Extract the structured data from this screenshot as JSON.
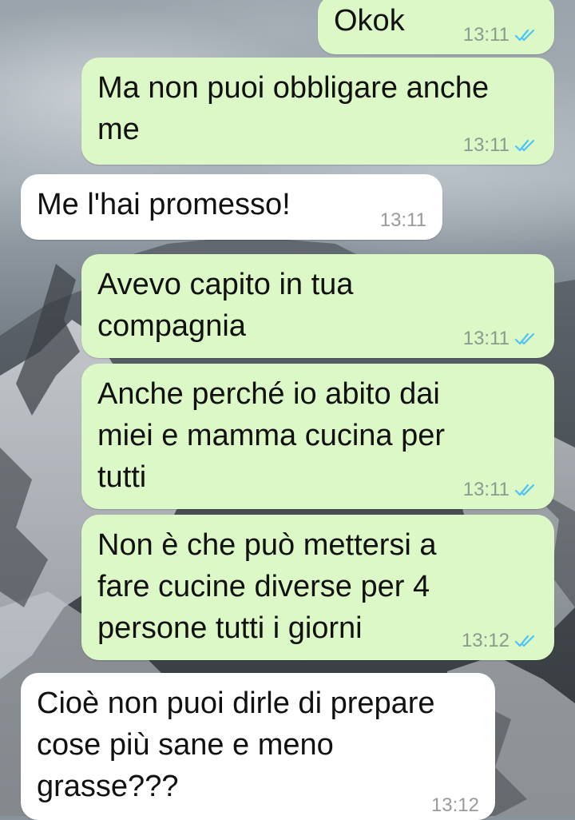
{
  "conversation": {
    "messages": [
      {
        "direction": "out",
        "text": "Okok",
        "time": "13:11",
        "read": true
      },
      {
        "direction": "out",
        "text": "Ma non puoi obbligare anche\nme",
        "time": "13:11",
        "read": true
      },
      {
        "direction": "in",
        "text": "Me l'hai promesso!",
        "time": "13:11"
      },
      {
        "direction": "out",
        "text": "Avevo capito in tua\ncompagnia",
        "time": "13:11",
        "read": true
      },
      {
        "direction": "out",
        "text": "Anche perché io abito dai\nmiei e mamma cucina per\ntutti",
        "time": "13:11",
        "read": true
      },
      {
        "direction": "out",
        "text": "Non è che può mettersi a\nfare cucine diverse per 4\npersone tutti i giorni",
        "time": "13:12",
        "read": true
      },
      {
        "direction": "in",
        "text": "Cioè non puoi dirle di prepare\ncose più sane e meno\ngrasse???",
        "time": "13:12"
      }
    ]
  },
  "colors": {
    "outgoing_bubble": "#dcf8c6",
    "incoming_bubble": "#ffffff",
    "read_ticks": "#4fc3f7"
  },
  "icons": {
    "read_receipt": "double-check-icon"
  }
}
